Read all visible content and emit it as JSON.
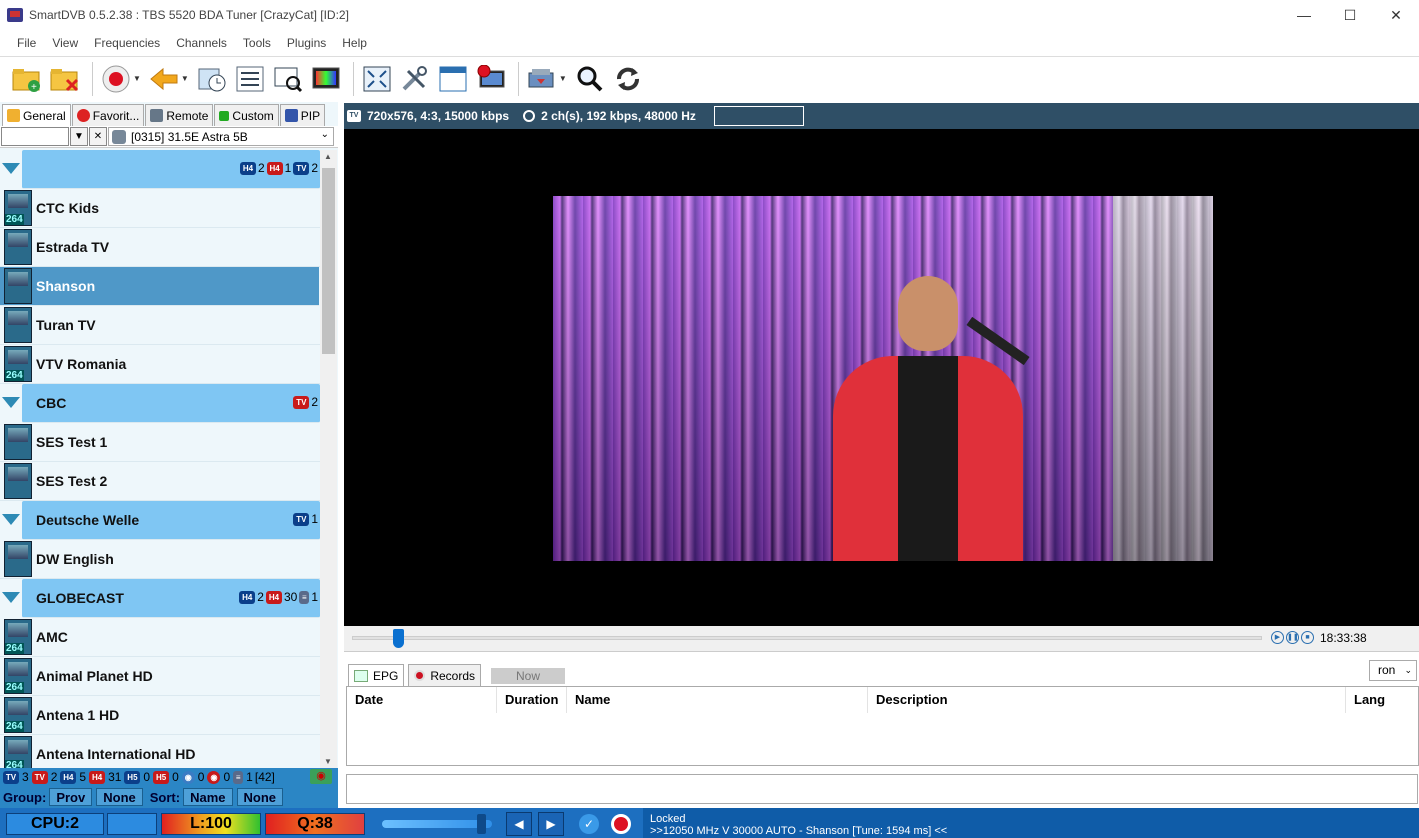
{
  "window": {
    "title": "SmartDVB 0.5.2.38 : TBS 5520 BDA Tuner [CrazyCat] [ID:2]",
    "minimize": "—",
    "maximize": "☐",
    "close": "✕"
  },
  "menu": [
    "File",
    "View",
    "Frequencies",
    "Channels",
    "Tools",
    "Plugins",
    "Help"
  ],
  "left": {
    "tabs": [
      "General",
      "Favorit...",
      "Remote",
      "Custom",
      "PIP"
    ],
    "satellite": "[0315] 31.5E  Astra 5B",
    "groups": [
      {
        "name": "",
        "counts": [
          "2",
          "1",
          "2"
        ]
      },
      {
        "name": "CBC",
        "counts": [
          "2"
        ]
      },
      {
        "name": "Deutsche Welle",
        "counts": [
          "1"
        ]
      },
      {
        "name": "GLOBECAST",
        "counts": [
          "2",
          "30",
          "1"
        ]
      }
    ],
    "channels": {
      "ctc_kids": "CTC Kids",
      "estrada_tv": "Estrada TV",
      "shanson": "Shanson",
      "turan_tv": "Turan TV",
      "vtv_romania": "VTV Romania",
      "ses_test_1": "SES Test 1",
      "ses_test_2": "SES Test 2",
      "dw_english": "DW English",
      "amc": "AMC",
      "animal_planet_hd": "Animal Planet HD",
      "antena_1_hd": "Antena 1 HD",
      "antena_international_hd": "Antena International HD"
    },
    "stats": [
      "3",
      "2",
      "5",
      "31",
      "0",
      "0",
      "0",
      "0",
      "1",
      "[42]"
    ],
    "group_label": "Group:",
    "group_prov": "Prov",
    "group_none": "None",
    "sort_label": "Sort:",
    "sort_name": "Name",
    "sort_none": "None"
  },
  "video": {
    "info_video": "720x576, 4:3, 15000 kbps",
    "info_audio": "2 ch(s), 192 kbps, 48000 Hz",
    "time": "18:33:38",
    "seek_fraction": 0.05
  },
  "epg": {
    "tab_epg": "EPG",
    "tab_records": "Records",
    "now": "Now",
    "lang": "ron",
    "cols": [
      "Date",
      "Duration",
      "Name",
      "Description",
      "Lang"
    ]
  },
  "status": {
    "cpu": "CPU:2",
    "level": "L:100",
    "quality": "Q:38",
    "volume_fraction": 0.9,
    "lock": "Locked",
    "tune": ">>12050 MHz V 30000 AUTO - Shanson [Tune: 1594 ms] <<"
  },
  "colors": {
    "accent": "#2b86c5",
    "group": "#7fc6f3",
    "selected": "#4f98c8",
    "status": "#1d6fc0"
  }
}
